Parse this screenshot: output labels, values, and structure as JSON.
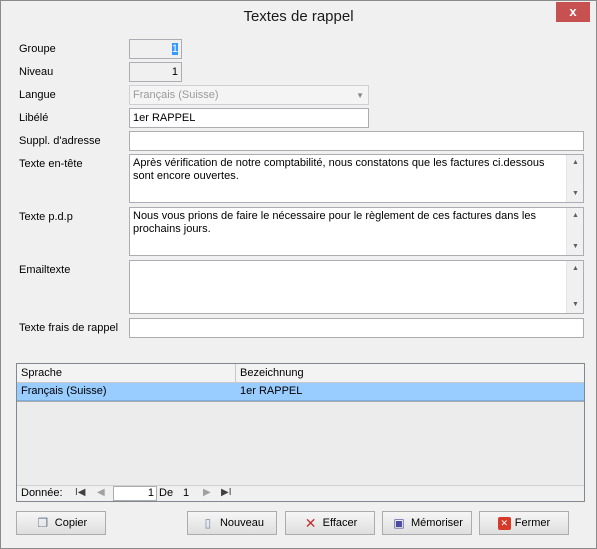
{
  "window": {
    "title": "Textes de rappel",
    "close_glyph": "x"
  },
  "form": {
    "groupe": {
      "label": "Groupe",
      "value": "1"
    },
    "niveau": {
      "label": "Niveau",
      "value": "1"
    },
    "langue": {
      "label": "Langue",
      "value": "Français (Suisse)"
    },
    "libelle": {
      "label": "Libélé",
      "value": "1er RAPPEL"
    },
    "suppl": {
      "label": "Suppl. d'adresse",
      "value": ""
    },
    "texte_entete": {
      "label": "Texte en-tête",
      "value": "Après vérification de notre comptabilité,  nous constatons que les factures ci.dessous sont encore ouvertes."
    },
    "texte_pdp": {
      "label": "Texte p.d.p",
      "value": "Nous vous prions de faire le nécessaire pour le règlement de ces factures dans les prochains jours."
    },
    "emailtexte": {
      "label": "Emailtexte",
      "value": ""
    },
    "frais": {
      "label": "Texte frais de rappel",
      "value": ""
    }
  },
  "grid": {
    "columns": [
      "Sprache",
      "Bezeichnung"
    ],
    "rows": [
      {
        "sprache": "Français (Suisse)",
        "bezeichnung": "1er RAPPEL"
      }
    ]
  },
  "navigator": {
    "label": "Donnée:",
    "current": "1",
    "of_label": "De",
    "total": "1"
  },
  "buttons": {
    "copier": "Copier",
    "nouveau": "Nouveau",
    "effacer": "Effacer",
    "memoriser": "Mémoriser",
    "fermer": "Fermer"
  },
  "icons": {
    "copy": "copy-icon",
    "new": "new-document-icon",
    "delete": "delete-x-icon",
    "save": "floppy-disk-icon",
    "close": "close-icon"
  },
  "colors": {
    "selected_row": "#99ccff",
    "close_button": "#c75050",
    "selection_highlight": "#3399ff"
  }
}
